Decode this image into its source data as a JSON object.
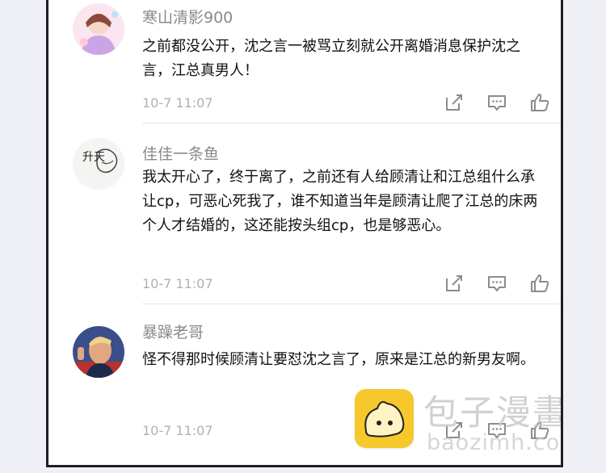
{
  "comments": [
    {
      "username": "寒山清影900",
      "text": "之前都没公开，沈之言一被骂立刻就公开离婚消息保护沈之言，江总真男人！",
      "time": "10-7 11:07"
    },
    {
      "username": "佳佳一条鱼",
      "text": "我太开心了，终于离了，之前还有人给顾清让和江总组什么承让cp，可恶心死我了，谁不知道当年是顾清让爬了江总的床两个人才结婚的，这还能按头组cp，也是够恶心。",
      "time": "10-7 11:07",
      "avatar_glyphs": "升天"
    },
    {
      "username": "暴躁老哥",
      "text": "怪不得那时候顾清让要怼沈之言了，原来是江总的新男友啊。",
      "time": "10-7 11:07"
    }
  ],
  "icons": [
    "share-icon",
    "comment-icon",
    "like-icon"
  ],
  "watermark": {
    "title": "包子漫畫",
    "url": "baozimh.com"
  },
  "colors": {
    "background": "#ffffff",
    "username": "#8a8a8a",
    "text": "#111111",
    "meta": "#b0b0b0",
    "icon": "#8c8c8c",
    "watermark_logo": "#f6c82b"
  }
}
